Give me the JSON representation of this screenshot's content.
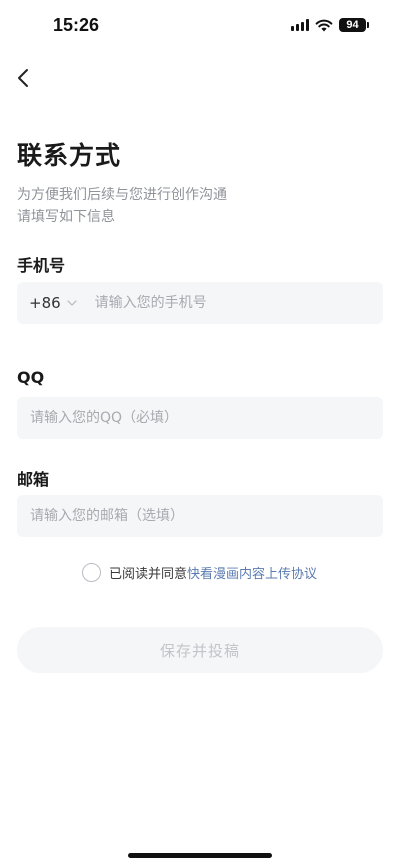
{
  "status_bar": {
    "time": "15:26",
    "battery": "94",
    "icons": [
      "signal-icon",
      "wifi-icon",
      "battery-icon"
    ]
  },
  "nav": {
    "back_icon": "chevron-left-icon"
  },
  "header": {
    "title": "联系方式",
    "subtitle_lines": [
      "为方便我们后续与您进行创作沟通",
      "请填写如下信息"
    ]
  },
  "form": {
    "phone": {
      "label": "手机号",
      "country_code": "+86",
      "value": "",
      "placeholder": "请输入您的手机号"
    },
    "qq": {
      "label": "QQ",
      "value": "",
      "placeholder": "请输入您的QQ（必填）"
    },
    "email": {
      "label": "邮箱",
      "value": "",
      "placeholder": "请输入您的邮箱（选填）"
    }
  },
  "agreement": {
    "checked": false,
    "text": "已阅读并同意",
    "link_text": "快看漫画内容上传协议"
  },
  "submit": {
    "label": "保存并投稿"
  },
  "colors": {
    "link": "#5b7bb0",
    "field_background": "#f5f6f7",
    "subtitle": "#8f939a",
    "disabled_button_text": "#c1c4c9"
  }
}
